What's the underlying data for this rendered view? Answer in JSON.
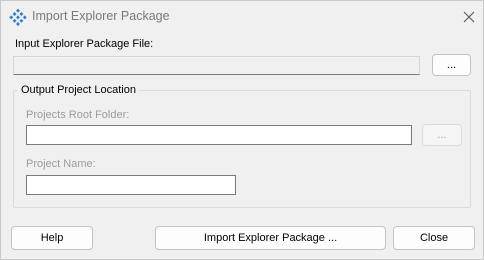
{
  "window": {
    "title": "Import Explorer Package",
    "app_icon": "diamond-grid-icon",
    "close_icon": "close-icon"
  },
  "input_package": {
    "label": "Input Explorer Package File:",
    "value": "",
    "browse_label": "..."
  },
  "output_group": {
    "title": "Output Project Location",
    "root_folder_label": "Projects Root Folder:",
    "root_folder_value": "",
    "browse_label": "...",
    "project_name_label": "Project Name:",
    "project_name_value": ""
  },
  "footer": {
    "help_label": "Help",
    "import_label": "Import Explorer Package ...",
    "close_label": "Close"
  },
  "colors": {
    "icon_blue": "#2f7fd0",
    "disabled_text": "#9b9b9b",
    "window_bg": "#f0f0f0"
  }
}
